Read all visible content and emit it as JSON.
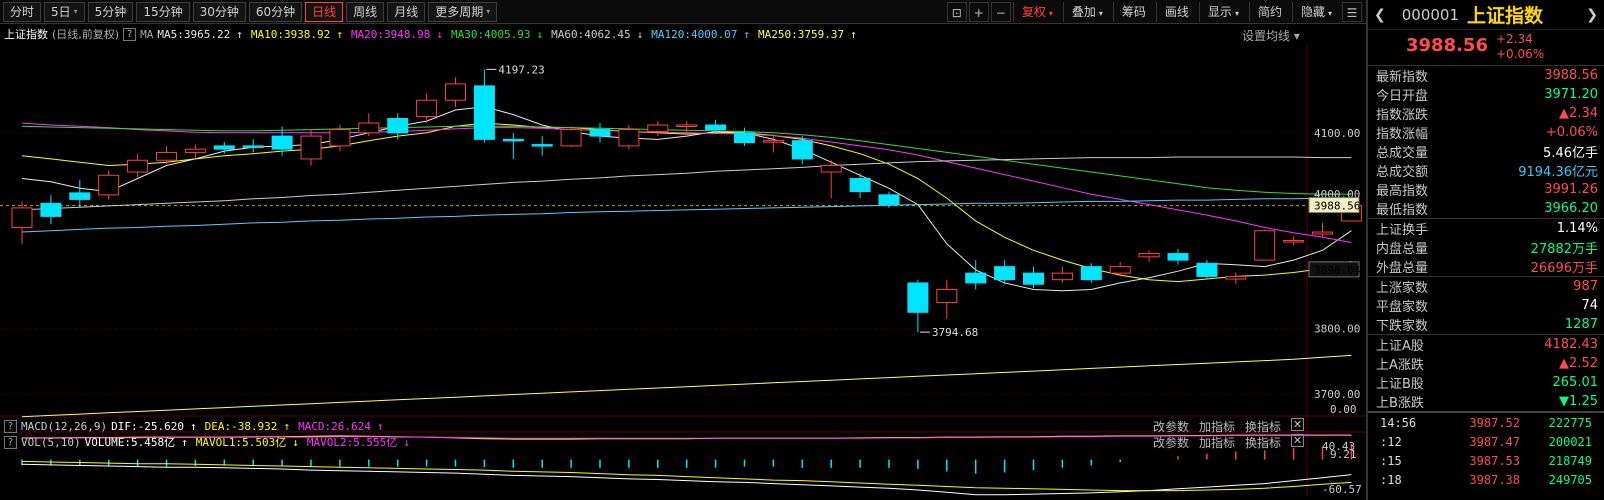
{
  "toolbar": {
    "periods": [
      {
        "label": "分时"
      },
      {
        "label": "5日",
        "dd": true
      },
      {
        "label": "5分钟"
      },
      {
        "label": "15分钟"
      },
      {
        "label": "30分钟"
      },
      {
        "label": "60分钟"
      },
      {
        "label": "日线",
        "active": true
      },
      {
        "label": "周线"
      },
      {
        "label": "月线"
      },
      {
        "label": "更多周期",
        "dd": true
      }
    ],
    "right": [
      {
        "label": "复权",
        "dd": true,
        "red": true
      },
      {
        "label": "叠加",
        "dd": true
      },
      {
        "label": "筹码"
      },
      {
        "label": "画线"
      },
      {
        "label": "显示",
        "dd": true
      },
      {
        "label": "简约"
      },
      {
        "label": "隐藏",
        "dd": true
      }
    ]
  },
  "legend": {
    "title": "上证指数",
    "sub": "(日线,前复权)",
    "q": "?",
    "ma": "MA",
    "items": [
      {
        "label": "MA5:3965.22",
        "arrow": "↑",
        "color": "#e8e8e8"
      },
      {
        "label": "MA10:3938.92",
        "arrow": "↑",
        "color": "#ffff00"
      },
      {
        "label": "MA20:3948.98",
        "arrow": "↓",
        "color": "#ff33ff"
      },
      {
        "label": "MA30:4005.93",
        "arrow": "↓",
        "color": "#33dd33"
      },
      {
        "label": "MA60:4062.45",
        "arrow": "↓",
        "color": "#cccccc"
      },
      {
        "label": "MA120:4000.07",
        "arrow": "↑",
        "color": "#55ccff"
      },
      {
        "label": "MA250:3759.37",
        "arrow": "↑",
        "color": "#ffff55"
      }
    ],
    "settings": "设置均线"
  },
  "vol_legend": {
    "q": "?",
    "name": "VOL(5,10)",
    "items": [
      {
        "label": "VOLUME:5.458亿",
        "arrow": "↑",
        "color": "#ffffff"
      },
      {
        "label": "MAVOL1:5.503亿",
        "arrow": "↓",
        "color": "#ffff00"
      },
      {
        "label": "MAVOL2:5.555亿",
        "arrow": "↓",
        "color": "#ff33ff"
      }
    ]
  },
  "macd_legend": {
    "q": "?",
    "name": "MACD(12,26,9)",
    "items": [
      {
        "label": "DIF:-25.620",
        "arrow": "↑",
        "color": "#ffffff"
      },
      {
        "label": "DEA:-38.932",
        "arrow": "↑",
        "color": "#ffff00"
      },
      {
        "label": "MACD:26.624",
        "arrow": "↑",
        "color": "#ff33ff"
      }
    ]
  },
  "subtool": {
    "params": "改参数",
    "add": "加指标",
    "swap": "换指标",
    "close": "✕"
  },
  "axis": {
    "price": [
      "4100.00",
      "3800.00",
      "3700.00"
    ],
    "price_current": "3988.56",
    "price_ref": "3890.04",
    "price_partial": "4000.00",
    "vol": [
      "9.21",
      "0.00"
    ],
    "macd": [
      "40.43",
      "-60.57"
    ]
  },
  "annotations": {
    "high": "4197.23",
    "low": "3794.68"
  },
  "chart_data": {
    "type": "candlestick",
    "title": "",
    "ylim": [
      3660,
      4230
    ],
    "candles": [
      {
        "o": 3955,
        "c": 3985,
        "h": 3995,
        "l": 3930
      },
      {
        "o": 3992,
        "c": 3972,
        "h": 4005,
        "l": 3960
      },
      {
        "o": 4008,
        "c": 3998,
        "h": 4028,
        "l": 3985
      },
      {
        "o": 4005,
        "c": 4035,
        "h": 4042,
        "l": 3998
      },
      {
        "o": 4040,
        "c": 4058,
        "h": 4068,
        "l": 4032
      },
      {
        "o": 4058,
        "c": 4070,
        "h": 4080,
        "l": 4052
      },
      {
        "o": 4070,
        "c": 4075,
        "h": 4082,
        "l": 4062
      },
      {
        "o": 4080,
        "c": 4075,
        "h": 4086,
        "l": 4068
      },
      {
        "o": 4080,
        "c": 4078,
        "h": 4090,
        "l": 4070
      },
      {
        "o": 4095,
        "c": 4075,
        "h": 4110,
        "l": 4065
      },
      {
        "o": 4060,
        "c": 4095,
        "h": 4105,
        "l": 4050
      },
      {
        "o": 4080,
        "c": 4105,
        "h": 4112,
        "l": 4072
      },
      {
        "o": 4100,
        "c": 4115,
        "h": 4130,
        "l": 4095
      },
      {
        "o": 4122,
        "c": 4100,
        "h": 4130,
        "l": 4090
      },
      {
        "o": 4125,
        "c": 4150,
        "h": 4160,
        "l": 4115
      },
      {
        "o": 4150,
        "c": 4175,
        "h": 4185,
        "l": 4140
      },
      {
        "o": 4172,
        "c": 4090,
        "h": 4197.23,
        "l": 4085
      },
      {
        "o": 4090,
        "c": 4088,
        "h": 4100,
        "l": 4060
      },
      {
        "o": 4082,
        "c": 4080,
        "h": 4095,
        "l": 4065
      },
      {
        "o": 4080,
        "c": 4105,
        "h": 4110,
        "l": 4078
      },
      {
        "o": 4105,
        "c": 4095,
        "h": 4115,
        "l": 4085
      },
      {
        "o": 4080,
        "c": 4105,
        "h": 4112,
        "l": 4075
      },
      {
        "o": 4102,
        "c": 4112,
        "h": 4118,
        "l": 4095
      },
      {
        "o": 4110,
        "c": 4112,
        "h": 4118,
        "l": 4100
      },
      {
        "o": 4112,
        "c": 4105,
        "h": 4120,
        "l": 4098
      },
      {
        "o": 4100,
        "c": 4085,
        "h": 4108,
        "l": 4080
      },
      {
        "o": 4088,
        "c": 4088,
        "h": 4098,
        "l": 4070
      },
      {
        "o": 4088,
        "c": 4060,
        "h": 4095,
        "l": 4052
      },
      {
        "o": 4040,
        "c": 4050,
        "h": 4058,
        "l": 4000
      },
      {
        "o": 4030,
        "c": 4010,
        "h": 4038,
        "l": 4000
      },
      {
        "o": 4005,
        "c": 3990,
        "h": 4010,
        "l": 3985
      },
      {
        "o": 3870,
        "c": 3825,
        "h": 3875,
        "l": 3794.68
      },
      {
        "o": 3840,
        "c": 3860,
        "h": 3875,
        "l": 3815
      },
      {
        "o": 3885,
        "c": 3870,
        "h": 3905,
        "l": 3860
      },
      {
        "o": 3895,
        "c": 3875,
        "h": 3905,
        "l": 3868
      },
      {
        "o": 3885,
        "c": 3868,
        "h": 3895,
        "l": 3862
      },
      {
        "o": 3875,
        "c": 3885,
        "h": 3895,
        "l": 3870
      },
      {
        "o": 3895,
        "c": 3875,
        "h": 3900,
        "l": 3870
      },
      {
        "o": 3885,
        "c": 3895,
        "h": 3902,
        "l": 3880
      },
      {
        "o": 3910,
        "c": 3915,
        "h": 3920,
        "l": 3902
      },
      {
        "o": 3915,
        "c": 3905,
        "h": 3922,
        "l": 3898
      },
      {
        "o": 3900,
        "c": 3880,
        "h": 3905,
        "l": 3875
      },
      {
        "o": 3876,
        "c": 3880,
        "h": 3886,
        "l": 3868
      },
      {
        "o": 3905,
        "c": 3950,
        "h": 3952,
        "l": 3905
      },
      {
        "o": 3935,
        "c": 3935,
        "h": 3942,
        "l": 3928
      },
      {
        "o": 3945,
        "c": 3948,
        "h": 3962,
        "l": 3940
      },
      {
        "o": 3965,
        "c": 3988.56,
        "h": 3991.26,
        "l": 3966.2
      }
    ],
    "ma": [
      {
        "name": "MA5",
        "color": "#e8e8e8",
        "values": [
          4030,
          4025,
          4015,
          4010,
          4030,
          4050,
          4060,
          4072,
          4078,
          4080,
          4082,
          4090,
          4100,
          4110,
          4118,
          4135,
          4140,
          4128,
          4112,
          4102,
          4095,
          4092,
          4090,
          4095,
          4102,
          4100,
          4090,
          4075,
          4055,
          4035,
          4015,
          3990,
          3930,
          3890,
          3870,
          3860,
          3858,
          3860,
          3870,
          3878,
          3888,
          3900,
          3898,
          3895,
          3905,
          3920,
          3950
        ]
      },
      {
        "name": "MA10",
        "color": "#ffff00",
        "values": [
          4065,
          4060,
          4055,
          4050,
          4052,
          4055,
          4060,
          4065,
          4068,
          4072,
          4075,
          4080,
          4088,
          4095,
          4100,
          4110,
          4115,
          4112,
          4108,
          4108,
          4105,
          4102,
          4100,
          4098,
          4100,
          4100,
          4096,
          4090,
          4080,
          4068,
          4052,
          4030,
          4000,
          3965,
          3940,
          3920,
          3905,
          3892,
          3882,
          3875,
          3872,
          3876,
          3880,
          3882,
          3886,
          3892,
          3903
        ]
      },
      {
        "name": "MA20",
        "color": "#ff33ff",
        "values": [
          4115,
          4112,
          4110,
          4108,
          4105,
          4103,
          4101,
          4100,
          4100,
          4100,
          4100,
          4100,
          4101,
          4102,
          4104,
          4106,
          4108,
          4108,
          4107,
          4105,
          4104,
          4102,
          4101,
          4100,
          4099,
          4098,
          4096,
          4092,
          4086,
          4080,
          4074,
          4066,
          4056,
          4046,
          4036,
          4026,
          4016,
          4006,
          3998,
          3990,
          3982,
          3974,
          3965,
          3955,
          3947,
          3940,
          3932
        ]
      },
      {
        "name": "MA30",
        "color": "#33dd33",
        "values": [
          4110,
          4109,
          4108,
          4107,
          4106,
          4105,
          4104,
          4103,
          4103,
          4104,
          4105,
          4106,
          4107,
          4108,
          4109,
          4110,
          4110,
          4110,
          4109,
          4108,
          4107,
          4106,
          4105,
          4104,
          4103,
          4102,
          4100,
          4097,
          4093,
          4088,
          4082,
          4076,
          4070,
          4064,
          4058,
          4052,
          4046,
          4040,
          4034,
          4028,
          4022,
          4016,
          4012,
          4009,
          4007,
          4006,
          4006
        ]
      },
      {
        "name": "MA60",
        "color": "#cccccc",
        "values": [
          3982,
          3984,
          3986,
          3988,
          3990,
          3992,
          3994,
          3996,
          3999,
          4001,
          4004,
          4006,
          4009,
          4012,
          4015,
          4018,
          4021,
          4024,
          4026,
          4029,
          4031,
          4034,
          4036,
          4038,
          4041,
          4043,
          4045,
          4047,
          4050,
          4052,
          4054,
          4056,
          4057,
          4058,
          4059,
          4060,
          4061,
          4062,
          4062,
          4062,
          4063,
          4063,
          4063,
          4063,
          4063,
          4062,
          4062
        ]
      },
      {
        "name": "MA120",
        "color": "#55ccff",
        "values": [
          3948,
          3950,
          3952,
          3954,
          3955,
          3957,
          3958,
          3960,
          3962,
          3963,
          3965,
          3966,
          3968,
          3969,
          3971,
          3972,
          3974,
          3975,
          3976,
          3978,
          3979,
          3980,
          3981,
          3982,
          3983,
          3984,
          3985,
          3986,
          3987,
          3988,
          3989,
          3990,
          3991,
          3992,
          3992,
          3993,
          3994,
          3995,
          3995,
          3996,
          3997,
          3997,
          3998,
          3999,
          3999,
          4000,
          4000
        ]
      },
      {
        "name": "MA250",
        "color": "#ffff55",
        "values": [
          3665,
          3667,
          3669,
          3671,
          3673,
          3675,
          3677,
          3679,
          3681,
          3683,
          3685,
          3687,
          3689,
          3691,
          3693,
          3695,
          3697,
          3699,
          3701,
          3703,
          3705,
          3707,
          3709,
          3711,
          3713,
          3715,
          3717,
          3719,
          3721,
          3723,
          3725,
          3727,
          3729,
          3731,
          3733,
          3735,
          3737,
          3739,
          3741,
          3743,
          3745,
          3747,
          3749,
          3751,
          3753,
          3756,
          3759
        ]
      }
    ],
    "volume": {
      "ylim": [
        0,
        9.21
      ],
      "values": [
        6.7,
        6.8,
        5.6,
        5.5,
        6.5,
        6.1,
        5.9,
        5.7,
        4.9,
        5.9,
        4.8,
        4.6,
        5.8,
        6.4,
        6.3,
        7.3,
        7.6,
        7.3,
        6.9,
        6.3,
        6.4,
        7.1,
        6.8,
        6.5,
        6.7,
        6.6,
        6.4,
        6.8,
        6.6,
        6.2,
        5.7,
        6.7,
        6.3,
        6.0,
        6.6,
        5.8,
        5.9,
        6.0,
        5.3,
        5.9,
        5.7,
        5.2,
        5.4,
        5.3,
        4.9,
        5.2,
        5.5
      ],
      "mavol1": [
        6.2,
        6.2,
        6.1,
        6.1,
        6.0,
        6.0,
        6.0,
        6.0,
        5.9,
        5.9,
        5.8,
        5.7,
        5.8,
        5.9,
        6.0,
        6.2,
        6.4,
        6.5,
        6.5,
        6.5,
        6.4,
        6.4,
        6.4,
        6.4,
        6.3,
        6.3,
        6.3,
        6.3,
        6.3,
        6.2,
        6.1,
        6.1,
        6.0,
        6.0,
        5.9,
        5.9,
        5.8,
        5.8,
        5.7,
        5.7,
        5.6,
        5.6,
        5.5,
        5.5,
        5.5,
        5.5,
        5.5
      ],
      "mavol2": [
        6.3,
        6.3,
        6.2,
        6.2,
        6.2,
        6.1,
        6.1,
        6.1,
        6.0,
        6.0,
        6.0,
        5.9,
        5.9,
        6.0,
        6.0,
        6.1,
        6.2,
        6.3,
        6.3,
        6.3,
        6.3,
        6.3,
        6.3,
        6.3,
        6.3,
        6.3,
        6.3,
        6.3,
        6.3,
        6.3,
        6.2,
        6.2,
        6.1,
        6.1,
        6.0,
        6.0,
        5.9,
        5.9,
        5.8,
        5.8,
        5.7,
        5.7,
        5.6,
        5.6,
        5.6,
        5.6,
        5.6
      ]
    },
    "macd": {
      "ylim": [
        -60.57,
        40.43
      ],
      "dif": [
        -8,
        -9,
        -10,
        -11,
        -12,
        -13,
        -13,
        -14,
        -15,
        -16,
        -18,
        -19,
        -20,
        -21,
        -22,
        -23,
        -25,
        -27,
        -28,
        -29,
        -31,
        -33,
        -34,
        -36,
        -38,
        -39,
        -41,
        -43,
        -45,
        -47,
        -49,
        -52,
        -56,
        -60,
        -60,
        -59,
        -58,
        -57,
        -55,
        -53,
        -50,
        -47,
        -44,
        -41,
        -36,
        -31,
        -25.62
      ],
      "dea": [
        -3,
        -4,
        -5,
        -6,
        -7,
        -7,
        -8,
        -9,
        -10,
        -11,
        -12,
        -13,
        -14,
        -15,
        -16,
        -17,
        -18,
        -20,
        -21,
        -22,
        -24,
        -26,
        -27,
        -29,
        -31,
        -33,
        -35,
        -36,
        -38,
        -40,
        -42,
        -44,
        -46,
        -48,
        -49,
        -50,
        -51,
        -52,
        -53,
        -53,
        -53,
        -52,
        -51,
        -49,
        -46,
        -42,
        -38.93
      ],
      "hist": [
        -10,
        -10,
        -11,
        -10,
        -11,
        -12,
        -11,
        -10,
        -10,
        -11,
        -12,
        -12,
        -12,
        -12,
        -12,
        -12,
        -13,
        -14,
        -14,
        -14,
        -14,
        -14,
        -14,
        -14,
        -14,
        -12,
        -12,
        -14,
        -14,
        -14,
        -14,
        -16,
        -20,
        -24,
        -22,
        -18,
        -14,
        -10,
        -4,
        0,
        6,
        10,
        14,
        16,
        20,
        22,
        26.62
      ]
    }
  },
  "panel": {
    "code": "000001",
    "name": "上证指数",
    "price": "3988.56",
    "change": "+2.34",
    "pct": "+0.06%",
    "stats": [
      {
        "label": "最新指数",
        "value": "3988.56",
        "color": "#ff4d4d"
      },
      {
        "label": "今日开盘",
        "value": "3971.20",
        "color": "#00ff88"
      },
      {
        "label": "指数涨跌",
        "value": "▲2.34",
        "color": "#ff4d4d"
      },
      {
        "label": "指数涨幅",
        "value": "+0.06%",
        "color": "#ff4d4d"
      },
      {
        "label": "总成交量",
        "value": "5.46亿手",
        "color": "#ffffff"
      },
      {
        "label": "总成交额",
        "value": "9194.36亿元",
        "color": "#33ccff"
      },
      {
        "label": "最高指数",
        "value": "3991.26",
        "color": "#ff4d4d"
      },
      {
        "label": "最低指数",
        "value": "3966.20",
        "color": "#00ff88"
      }
    ],
    "stats2": [
      {
        "label": "上证换手",
        "value": "1.14%",
        "color": "#ffffff"
      },
      {
        "label": "内盘总量",
        "value": "27882万手",
        "color": "#00ff88"
      },
      {
        "label": "外盘总量",
        "value": "26696万手",
        "color": "#ff4d4d"
      }
    ],
    "stats3": [
      {
        "label": "上涨家数",
        "value": "987",
        "color": "#ff4d4d"
      },
      {
        "label": "平盘家数",
        "value": "74",
        "color": "#ffffff"
      },
      {
        "label": "下跌家数",
        "value": "1287",
        "color": "#00ff88"
      }
    ],
    "stats4": [
      {
        "label": "上证A股",
        "value": "4182.43",
        "color": "#ff4d4d"
      },
      {
        "label": "上A涨跌",
        "value": "▲2.52",
        "color": "#ff4d4d"
      },
      {
        "label": "上证B股",
        "value": "265.01",
        "color": "#00ff88"
      },
      {
        "label": "上B涨跌",
        "value": "▼1.25",
        "color": "#00ff88"
      }
    ],
    "ticks": [
      {
        "time": "14:56",
        "price": "3987.52",
        "vol": "222775"
      },
      {
        "time": ":12",
        "price": "3987.47",
        "vol": "200021"
      },
      {
        "time": ":15",
        "price": "3987.53",
        "vol": "218749"
      },
      {
        "time": ":18",
        "price": "3987.38",
        "vol": "249705"
      }
    ]
  }
}
